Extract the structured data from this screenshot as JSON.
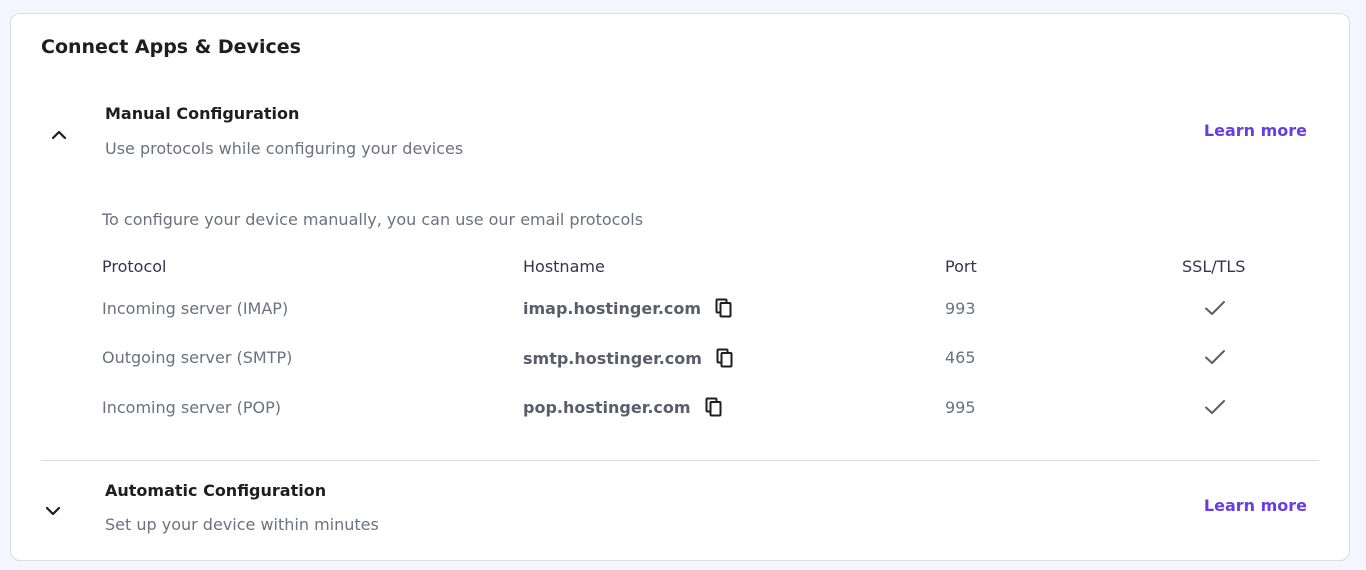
{
  "card": {
    "title": "Connect Apps & Devices"
  },
  "manual": {
    "title": "Manual Configuration",
    "subtitle": "Use protocols while configuring your devices",
    "learn_more": "Learn more",
    "toggle_icon": "chevron-up-icon",
    "intro": "To configure your device manually, you can use our email protocols",
    "columns": {
      "protocol": "Protocol",
      "hostname": "Hostname",
      "port": "Port",
      "ssl": "SSL/TLS"
    },
    "rows": [
      {
        "protocol": "Incoming server (IMAP)",
        "hostname": "imap.hostinger.com",
        "port": "993",
        "ssl": true
      },
      {
        "protocol": "Outgoing server (SMTP)",
        "hostname": "smtp.hostinger.com",
        "port": "465",
        "ssl": true
      },
      {
        "protocol": "Incoming server (POP)",
        "hostname": "pop.hostinger.com",
        "port": "995",
        "ssl": true
      }
    ]
  },
  "automatic": {
    "title": "Automatic Configuration",
    "subtitle": "Set up your device within minutes",
    "learn_more": "Learn more",
    "toggle_icon": "chevron-down-icon"
  },
  "colors": {
    "accent": "#673de6",
    "heading": "#1d1e20",
    "muted": "#6d7081",
    "border": "#dadce0",
    "background": "#f4f5ff"
  }
}
